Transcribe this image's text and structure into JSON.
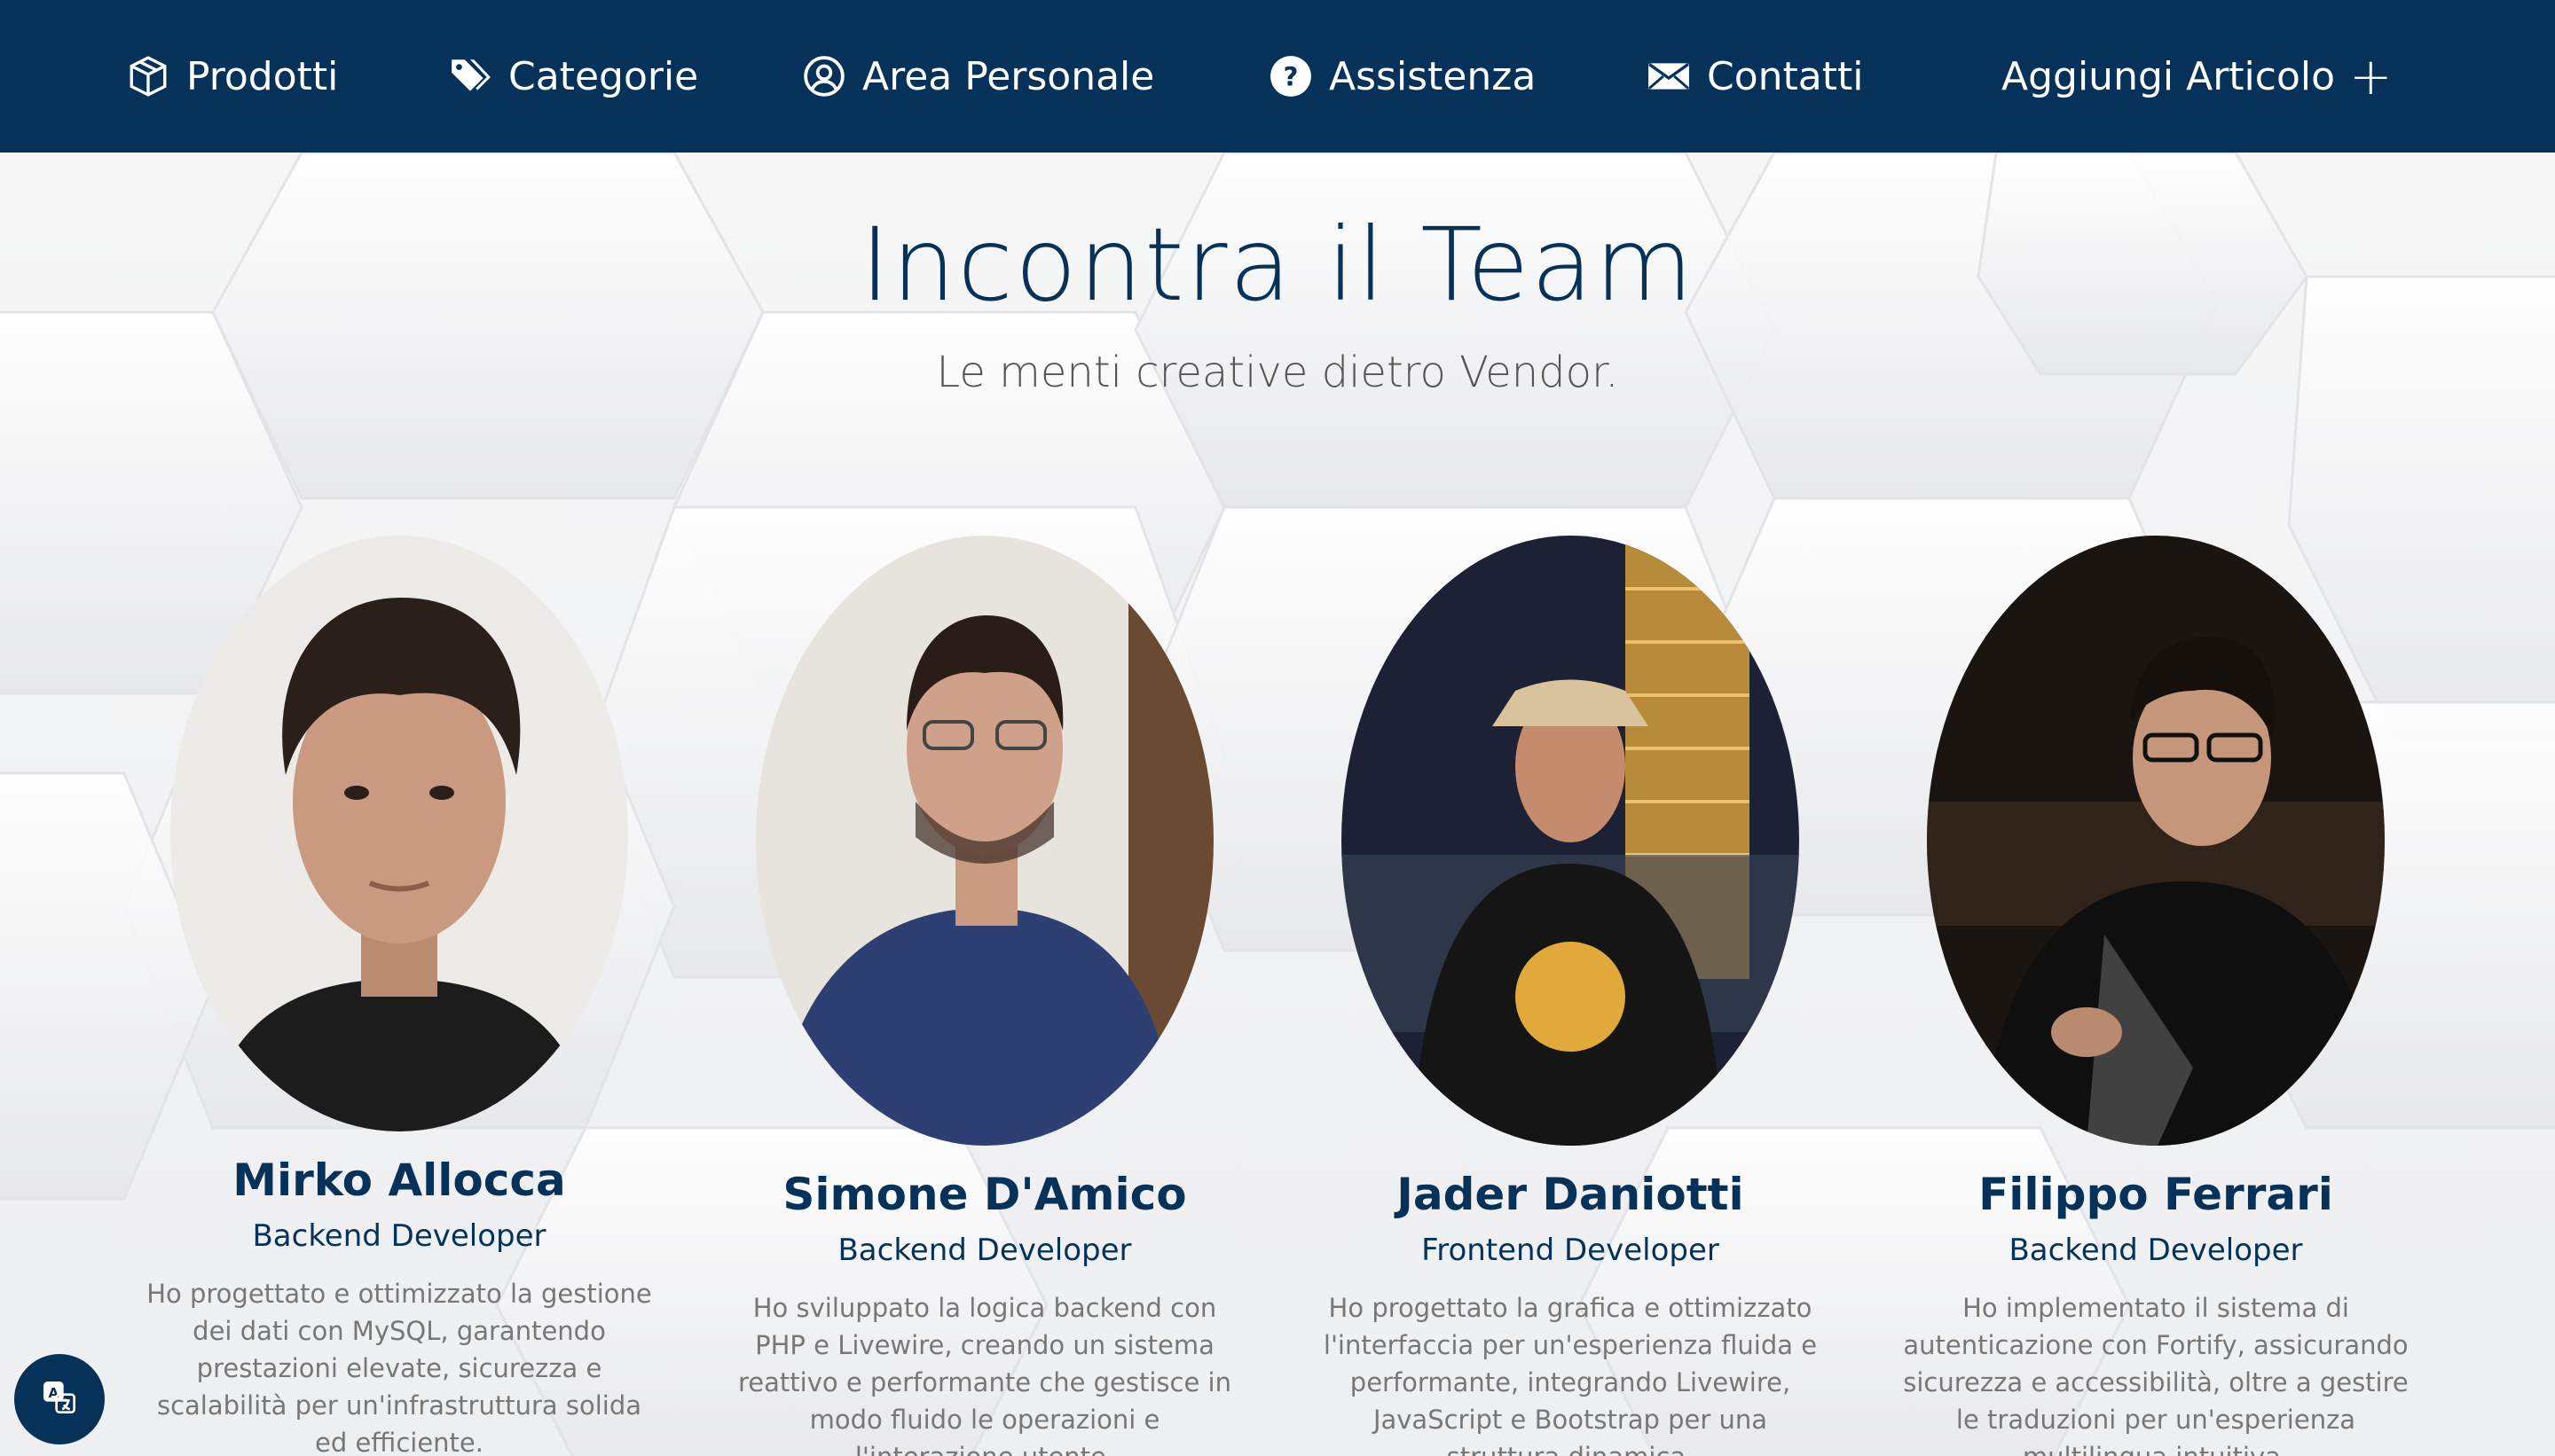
{
  "nav": {
    "items": [
      {
        "label": "Prodotti",
        "icon": "box-icon"
      },
      {
        "label": "Categorie",
        "icon": "tags-icon"
      },
      {
        "label": "Area Personale",
        "icon": "user-circle-icon"
      },
      {
        "label": "Assistenza",
        "icon": "question-circle-icon"
      },
      {
        "label": "Contatti",
        "icon": "envelope-icon"
      }
    ],
    "add_article": {
      "label": "Aggiungi Articolo",
      "icon": "plus-icon"
    }
  },
  "team": {
    "title": "Incontra il Team",
    "subtitle": "Le menti creative dietro Vendor.",
    "members": [
      {
        "name": "Mirko Allocca",
        "role": "Backend Developer",
        "description": "Ho progettato e ottimizzato la gestione dei dati con MySQL, garantendo prestazioni elevate, sicurezza e scalabilità per un'infrastruttura solida ed efficiente."
      },
      {
        "name": "Simone D'Amico",
        "role": "Backend Developer",
        "description": "Ho sviluppato la logica backend con PHP e Livewire, creando un sistema reattivo e performante che gestisce in modo fluido le operazioni e l'interazione utente."
      },
      {
        "name": "Jader Daniotti",
        "role": "Frontend Developer",
        "description": "Ho progettato la grafica e ottimizzato l'interfaccia per un'esperienza fluida e performante, integrando Livewire, JavaScript e Bootstrap per una struttura dinamica."
      },
      {
        "name": "Filippo Ferrari",
        "role": "Backend Developer",
        "description": "Ho implementato il sistema di autenticazione con Fortify, assicurando sicurezza e accessibilità, oltre a gestire le traduzioni per un'esperienza multilingua intuitiva."
      }
    ]
  },
  "translate_button": {
    "icon": "translate-icon"
  },
  "colors": {
    "navbar": "#06325a",
    "accent": "#06325a",
    "text_muted": "#777777"
  }
}
